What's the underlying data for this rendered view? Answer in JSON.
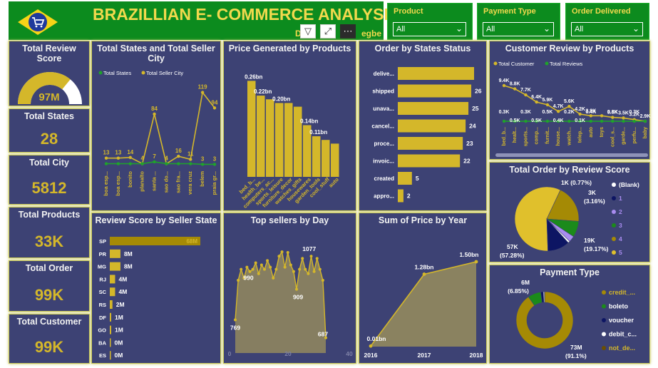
{
  "header": {
    "title": "BRAZILLIAN E- COMMERCE ANALYSIS",
    "author_fragment_left": "D",
    "author_fragment_right": "egbe"
  },
  "slicers": [
    {
      "label": "Product",
      "value": "All"
    },
    {
      "label": "Payment Type",
      "value": "All"
    },
    {
      "label": "Order Delivered",
      "value": "All"
    }
  ],
  "kpis": {
    "review_score": {
      "title": "Total Review Score",
      "value": "97M",
      "fill_fraction": 0.72
    },
    "states": {
      "title": "Total States",
      "value": "28"
    },
    "city": {
      "title": "Total City",
      "value": "5812"
    },
    "products": {
      "title": "Total Products",
      "value": "33K"
    },
    "order": {
      "title": "Total Order",
      "value": "99K"
    },
    "customer": {
      "title": "Total Customer",
      "value": "99K"
    }
  },
  "colors": {
    "gold": "#d4b72a",
    "green": "#1fa32a",
    "panel": "#3d4274",
    "olive": "#a58a05"
  },
  "chart_data": [
    {
      "type": "line",
      "title": "Total States and Total Seller City",
      "legend": [
        "Total States",
        "Total Seller City"
      ],
      "categories": [
        "boa esp...",
        "boa esp...",
        "bonito",
        "planalto",
        "santa ...",
        "sao do...",
        "sao fra...",
        "vera cruz",
        "belem",
        "praia gr..."
      ],
      "series": [
        {
          "name": "Total Seller City",
          "values": [
            13,
            13,
            14,
            4,
            84,
            4,
            16,
            11,
            119,
            94
          ],
          "labels": [
            "13",
            "13",
            "14",
            "4",
            "84",
            "4",
            "16",
            "11",
            "119",
            "94"
          ]
        },
        {
          "name": "Total States",
          "values": [
            4,
            4,
            4,
            4,
            7,
            4,
            4,
            4,
            3,
            3
          ],
          "labels": [
            "",
            "",
            "",
            "",
            "7",
            "4",
            "",
            "",
            "3",
            "3"
          ]
        }
      ]
    },
    {
      "type": "bar",
      "title": "Price Generated by Products",
      "categories": [
        "bed_b...",
        "health_be...",
        "computers_ac...",
        "sports_leisure",
        "furniture_decor",
        "watches_gifts",
        "housewares",
        "garden_tools",
        "cool_stuff",
        "auto"
      ],
      "values": [
        0.26,
        0.22,
        0.21,
        0.2,
        0.2,
        0.19,
        0.14,
        0.11,
        0.1,
        0.09
      ],
      "data_labels": [
        "0.26bn",
        "0.22bn",
        "",
        "0.20bn",
        "",
        "",
        "0.14bn",
        "0.11bn",
        "",
        ""
      ]
    },
    {
      "type": "bar",
      "title": "Order by States Status",
      "categories": [
        "delive...",
        "shipped",
        "unava...",
        "cancel...",
        "proce...",
        "invoic...",
        "created",
        "appro..."
      ],
      "values": [
        27,
        26,
        25,
        24,
        23,
        22,
        5,
        2
      ],
      "data_labels": [
        "",
        "26",
        "25",
        "24",
        "23",
        "22",
        "5",
        "2"
      ]
    },
    {
      "type": "line",
      "title": "Customer Review by Products",
      "legend": [
        "Total Customer",
        "Total Reviews"
      ],
      "categories": [
        "bed_b...",
        "healt...",
        "sports...",
        "comp...",
        "furnit...",
        "house...",
        "watch...",
        "telep...",
        "auto",
        "toys",
        "cool_s...",
        "garde...",
        "perfu...",
        "baby"
      ],
      "series": [
        {
          "name": "Total Customer",
          "values": [
            9.4,
            8.8,
            7.7,
            6.4,
            5.9,
            4.7,
            5.6,
            4.2,
            3.9,
            3.9,
            3.6,
            3.5,
            3.2,
            2.9
          ],
          "labels": [
            "9.4K",
            "8.8K",
            "7.7K",
            "6.4K",
            "5.9K",
            "4.7K",
            "5.6K",
            "4.2K",
            "3.9K",
            "",
            "3.6K",
            "3.5K",
            "3.2K",
            "2.9K"
          ]
        },
        {
          "name": "Total Reviews",
          "values": [
            0.3,
            0.5,
            0.3,
            0.5,
            0.5,
            0.4,
            0.2,
            0.1,
            0.4,
            0.4,
            0.3,
            0.3,
            0.3,
            0.3
          ],
          "labels": [
            "0.3K",
            "0.5K",
            "0.3K",
            "0.5K",
            "0.5K",
            "0.4K",
            "0.2K",
            "0.1K",
            "0.4K",
            "",
            "0.3K",
            "",
            "0.3K",
            ""
          ]
        }
      ]
    },
    {
      "type": "pie",
      "title": "Total Order by Review Score",
      "legend": [
        "(Blank)",
        "1",
        "2",
        "3",
        "4",
        "5"
      ],
      "slices": [
        {
          "name": "5",
          "value": 57,
          "label": "57K (57.28%)"
        },
        {
          "name": "4",
          "value": 19,
          "label": "19K (19.17%)"
        },
        {
          "name": "3",
          "value": 8,
          "label": ""
        },
        {
          "name": "2",
          "value": 3,
          "label": "3K (3.16%)"
        },
        {
          "name": "(Blank)",
          "value": 1,
          "label": "1K (0.77%)"
        },
        {
          "name": "1",
          "value": 11,
          "label": ""
        }
      ],
      "colors": [
        "#ffffff",
        "#0d1563",
        "#a98cf0",
        "#1b8a1b",
        "#a58a05",
        "#e0c02c"
      ]
    },
    {
      "type": "bar",
      "title": "Review Score by Seller State",
      "categories": [
        "SP",
        "PR",
        "MG",
        "RJ",
        "SC",
        "RS",
        "DF",
        "GO",
        "BA",
        "ES"
      ],
      "values": [
        68,
        8,
        8,
        4,
        4,
        2,
        1,
        1,
        0,
        0
      ],
      "data_labels": [
        "68M",
        "8M",
        "8M",
        "4M",
        "4M",
        "2M",
        "1M",
        "1M",
        "0M",
        "0M"
      ]
    },
    {
      "type": "area",
      "title": "Top sellers by Day",
      "x_ticks": [
        "0",
        "20",
        "40"
      ],
      "values": [
        769,
        950,
        1000,
        960,
        1010,
        990,
        1000,
        1030,
        980,
        1020,
        1000,
        1040,
        1010,
        960,
        1000,
        1060,
        1080,
        1010,
        1077,
        1020,
        990,
        909,
        1000,
        1050,
        1000,
        980,
        1060,
        990,
        1050,
        1000,
        950,
        687
      ],
      "data_labels": {
        "first": "769",
        "max": "1077",
        "mid": "909",
        "last": "687",
        "upper": "990"
      }
    },
    {
      "type": "area",
      "title": "Sum of Price by Year",
      "x": [
        "2016",
        "2017",
        "2018"
      ],
      "values": [
        0.01,
        1.28,
        1.5
      ],
      "data_labels": [
        "0.01bn",
        "1.28bn",
        "1.50bn"
      ]
    },
    {
      "type": "pie",
      "title": "Payment Type",
      "legend": [
        "credit_...",
        "boleto",
        "voucher",
        "debit_c...",
        "not_de..."
      ],
      "slices": [
        {
          "name": "credit_...",
          "value": 73,
          "label": "73M (91.1%)"
        },
        {
          "name": "boleto",
          "value": 6,
          "label": "6M (6.85%)"
        },
        {
          "name": "voucher",
          "value": 1.2,
          "label": ""
        },
        {
          "name": "debit_c...",
          "value": 0.5,
          "label": ""
        },
        {
          "name": "not_de...",
          "value": 0.1,
          "label": ""
        }
      ],
      "colors": [
        "#a58a05",
        "#1b8a1b",
        "#0d1563",
        "#ffffff",
        "#6b4e00"
      ]
    }
  ]
}
